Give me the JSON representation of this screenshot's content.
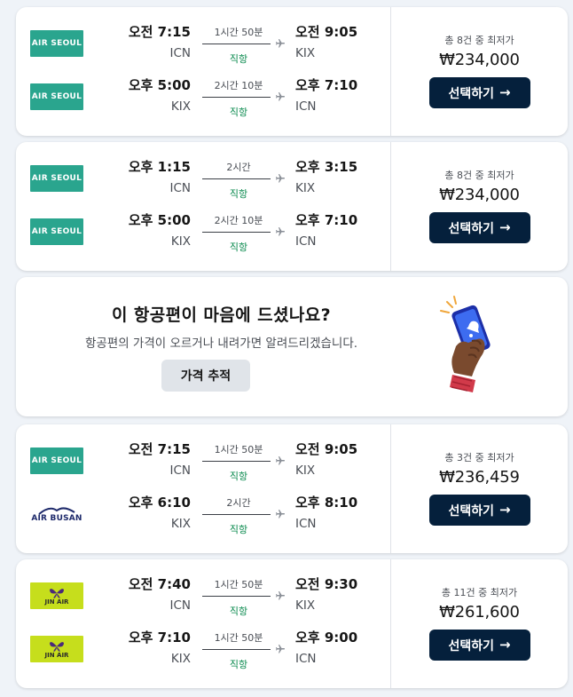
{
  "colors": {
    "airseoul": "#2aa58e",
    "jinair": "#c6de1c",
    "airbusan": "#1e2a6b",
    "button_dark": "#05203c",
    "direct_green": "#0a8a4e"
  },
  "flights": [
    {
      "legs": [
        {
          "airline": "AIR SEOUL",
          "logo": "airseoul",
          "dep_time": "오전 7:15",
          "dep_code": "ICN",
          "duration": "1시간 50분",
          "stops": "직항",
          "arr_time": "오전 9:05",
          "arr_code": "KIX"
        },
        {
          "airline": "AIR SEOUL",
          "logo": "airseoul",
          "dep_time": "오후 5:00",
          "dep_code": "KIX",
          "duration": "2시간 10분",
          "stops": "직항",
          "arr_time": "오후 7:10",
          "arr_code": "ICN"
        }
      ],
      "deals": "총 8건 중 최저가",
      "price": "₩234,000",
      "button": "선택하기"
    },
    {
      "legs": [
        {
          "airline": "AIR SEOUL",
          "logo": "airseoul",
          "dep_time": "오후 1:15",
          "dep_code": "ICN",
          "duration": "2시간",
          "stops": "직항",
          "arr_time": "오후 3:15",
          "arr_code": "KIX"
        },
        {
          "airline": "AIR SEOUL",
          "logo": "airseoul",
          "dep_time": "오후 5:00",
          "dep_code": "KIX",
          "duration": "2시간 10분",
          "stops": "직항",
          "arr_time": "오후 7:10",
          "arr_code": "ICN"
        }
      ],
      "deals": "총 8건 중 최저가",
      "price": "₩234,000",
      "button": "선택하기"
    },
    {
      "legs": [
        {
          "airline": "AIR SEOUL",
          "logo": "airseoul",
          "dep_time": "오전 7:15",
          "dep_code": "ICN",
          "duration": "1시간 50분",
          "stops": "직항",
          "arr_time": "오전 9:05",
          "arr_code": "KIX"
        },
        {
          "airline": "AIR BUSAN",
          "logo": "airbusan",
          "dep_time": "오후 6:10",
          "dep_code": "KIX",
          "duration": "2시간",
          "stops": "직항",
          "arr_time": "오후 8:10",
          "arr_code": "ICN"
        }
      ],
      "deals": "총 3건 중 최저가",
      "price": "₩236,459",
      "button": "선택하기"
    },
    {
      "legs": [
        {
          "airline": "JIN AIR",
          "logo": "jinair",
          "dep_time": "오전 7:40",
          "dep_code": "ICN",
          "duration": "1시간 50분",
          "stops": "직항",
          "arr_time": "오전 9:30",
          "arr_code": "KIX"
        },
        {
          "airline": "JIN AIR",
          "logo": "jinair",
          "dep_time": "오후 7:10",
          "dep_code": "KIX",
          "duration": "1시간 50분",
          "stops": "직항",
          "arr_time": "오후 9:00",
          "arr_code": "ICN"
        }
      ],
      "deals": "총 11건 중 최저가",
      "price": "₩261,600",
      "button": "선택하기"
    }
  ],
  "promo": {
    "title": "이 항공편이 마음에 드셨나요?",
    "subtitle": "항공편의 가격이 오르거나 내려가면 알려드리겠습니다.",
    "button": "가격 추적",
    "illustration": "hand-holding-phone-bell-icon"
  }
}
